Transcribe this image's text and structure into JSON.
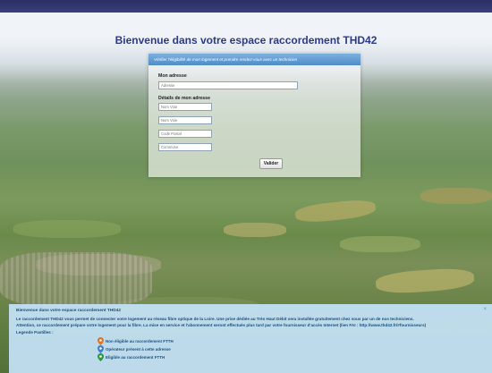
{
  "page": {
    "title": "Bienvenue dans votre espace raccordement THD42"
  },
  "form": {
    "header": "Vérifier l'éligibilité de mon logement et prendre rendez-vous avec un technicien",
    "address_label": "Mon adresse",
    "address_placeholder": "Adresse",
    "details_label": "Détails de mon adresse",
    "voie_placeholder": "Nom Voie",
    "voie2_placeholder": "Nom Voie",
    "postal_placeholder": "Code Postal",
    "commune_placeholder": "Commune",
    "submit_label": "Valider"
  },
  "info": {
    "close": "×",
    "title": "Bienvenue dans votre espace raccordement THD42",
    "line1": "Le raccordement THD42 vous permet de connecter votre logement au réseau fibre optique de la Loire. Une prise dédiée au Très Haut Débit sera installée gratuitement chez vous par un de nos techniciens.",
    "line2": "Attention, ce raccordement prépare votre logement pour la fibre. La mise en service et l'abonnement seront effectués plus tard par votre fournisseur d'accès Internet (lien FAI : http://www.thd42.fr/#fournisseurs)",
    "legend_label": "Legende Pastilles :",
    "legend": [
      {
        "label": "Non éligible au raccordement FTTH",
        "icon": "map-pin-orange-icon",
        "color": "#e8731f"
      },
      {
        "label": "Opérateur présent à cette adresse",
        "icon": "map-pin-blue-icon",
        "color": "#3a7fd0"
      },
      {
        "label": "Eligible au raccordement FTTH",
        "icon": "map-pin-green-icon",
        "color": "#2e9b3a"
      }
    ]
  },
  "colors": {
    "title_blue": "#2b3a8f",
    "header_blue": "#4f8dc8",
    "info_text": "#1d4f80"
  }
}
